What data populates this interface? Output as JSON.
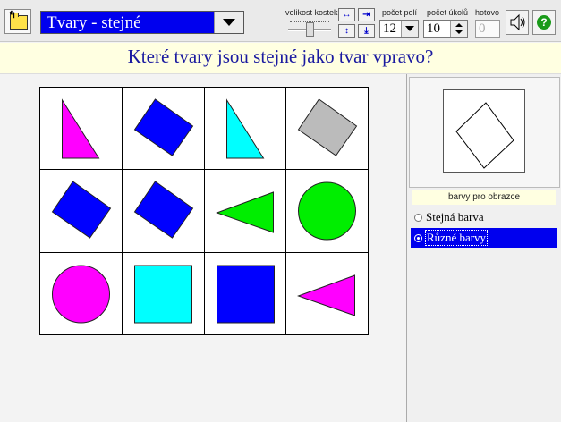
{
  "toolbar": {
    "exercise_title": "Tvary - stejné",
    "size_label": "velikost kostek",
    "field_count_label": "počet polí",
    "field_count_value": "12",
    "task_count_label": "počet úkolů",
    "task_count_value": "10",
    "done_label": "hotovo",
    "done_value": "0",
    "help_symbol": "?",
    "icons": [
      "folder-up-icon",
      "chevron-down-icon",
      "arrows-horizontal-out-icon",
      "arrows-horizontal-in-icon",
      "arrows-vertical-out-icon",
      "arrows-vertical-in-icon",
      "speaker-icon",
      "help-icon"
    ]
  },
  "question": "Které tvary jsou stejné jako tvar vpravo?",
  "grid": {
    "rows": 3,
    "cols": 4,
    "cells": [
      {
        "shape": "right-triangle",
        "color": "#ff00ff"
      },
      {
        "shape": "diamond",
        "color": "#0000ff"
      },
      {
        "shape": "right-triangle",
        "color": "#00ffff"
      },
      {
        "shape": "diamond",
        "color": "#bbbbbb"
      },
      {
        "shape": "diamond",
        "color": "#0000ff"
      },
      {
        "shape": "diamond",
        "color": "#0000ff"
      },
      {
        "shape": "triangle-left",
        "color": "#00ee00"
      },
      {
        "shape": "circle",
        "color": "#00ee00"
      },
      {
        "shape": "circle",
        "color": "#ff00ff"
      },
      {
        "shape": "square",
        "color": "#00ffff"
      },
      {
        "shape": "square",
        "color": "#0000ff"
      },
      {
        "shape": "triangle-left",
        "color": "#ff00ff"
      }
    ]
  },
  "target": {
    "shape": "diamond",
    "color": "#ffffff"
  },
  "panel": {
    "color_section_label": "barvy pro obrazce",
    "options": [
      {
        "label": "Stejná barva",
        "selected": false
      },
      {
        "label": "Různé barvy",
        "selected": true
      }
    ]
  }
}
